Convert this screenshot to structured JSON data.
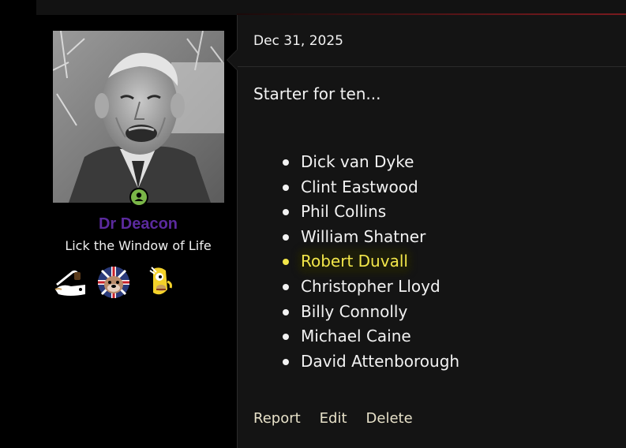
{
  "user": {
    "name": "Dr Deacon",
    "title": "Lick the Window of Life",
    "name_color": "#5b2a9e",
    "online_badge_color": "#7ab648",
    "avatar": "old-man-portrait",
    "trophies": [
      "pipe-smoker-trophy-icon",
      "bulldog-union-jack-trophy-icon",
      "cartoon-face-trophy-icon"
    ]
  },
  "post": {
    "date": "Dec 31, 2025",
    "intro": "Starter for ten...",
    "names": [
      {
        "name": "Dick van Dyke",
        "highlighted": false
      },
      {
        "name": "Clint Eastwood",
        "highlighted": false
      },
      {
        "name": "Phil Collins",
        "highlighted": false
      },
      {
        "name": "William Shatner",
        "highlighted": false
      },
      {
        "name": "Robert Duvall",
        "highlighted": true
      },
      {
        "name": "Christopher Lloyd",
        "highlighted": false
      },
      {
        "name": "Billy Connolly",
        "highlighted": false
      },
      {
        "name": "Michael Caine",
        "highlighted": false
      },
      {
        "name": "David Attenborough",
        "highlighted": false
      }
    ],
    "highlight_color": "#f3e74a"
  },
  "actions": {
    "report_label": "Report",
    "edit_label": "Edit",
    "delete_label": "Delete"
  }
}
